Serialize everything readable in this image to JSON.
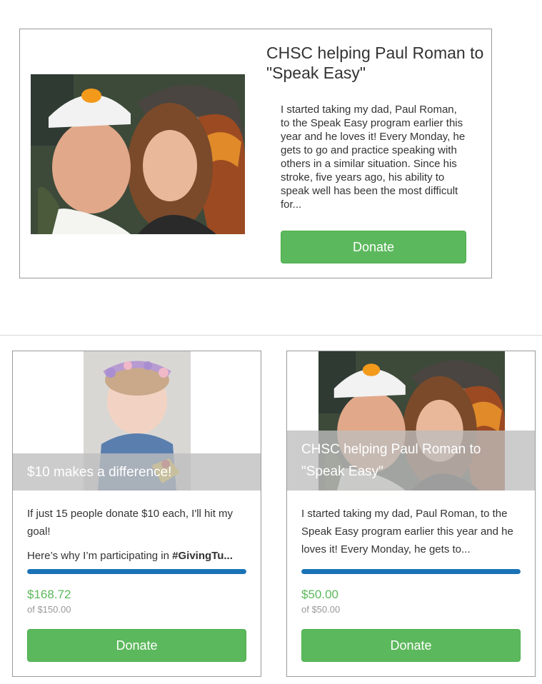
{
  "featured": {
    "title": "CHSC helping Paul Roman to \"Speak Easy\"",
    "description": "I started taking my dad, Paul Roman, to the Speak Easy program earlier this year and he loves it! Every Monday, he gets to go and practice speaking with others in a similar situation. Since his stroke, five years ago, his ability to speak well has been the most difficult for...",
    "donate_label": "Donate",
    "photo_icon": "selfie-photo"
  },
  "cards": [
    {
      "overlay_title": "$10 makes a difference!",
      "text1": "If just 15 people donate $10 each, I'll hit my goal!",
      "text2_prefix": "Here’s why I’m participating in ",
      "text2_bold": "#GivingTu...",
      "progress": 1.0,
      "raised": "$168.72",
      "goal": "of $150.00",
      "donate_label": "Donate",
      "photo_icon": "baby-photo"
    },
    {
      "overlay_title": "CHSC helping Paul Roman to \"Speak Easy\"",
      "text1": "I started taking my dad, Paul Roman, to the Speak Easy program earlier this year and he loves it! Every Monday, he gets to...",
      "progress": 1.0,
      "raised": "$50.00",
      "goal": "of $50.00",
      "donate_label": "Donate",
      "photo_icon": "selfie-photo"
    }
  ],
  "colors": {
    "donate_green": "#5cb85c",
    "progress_blue": "#1a73b6",
    "raised_green": "#5cb85c"
  }
}
